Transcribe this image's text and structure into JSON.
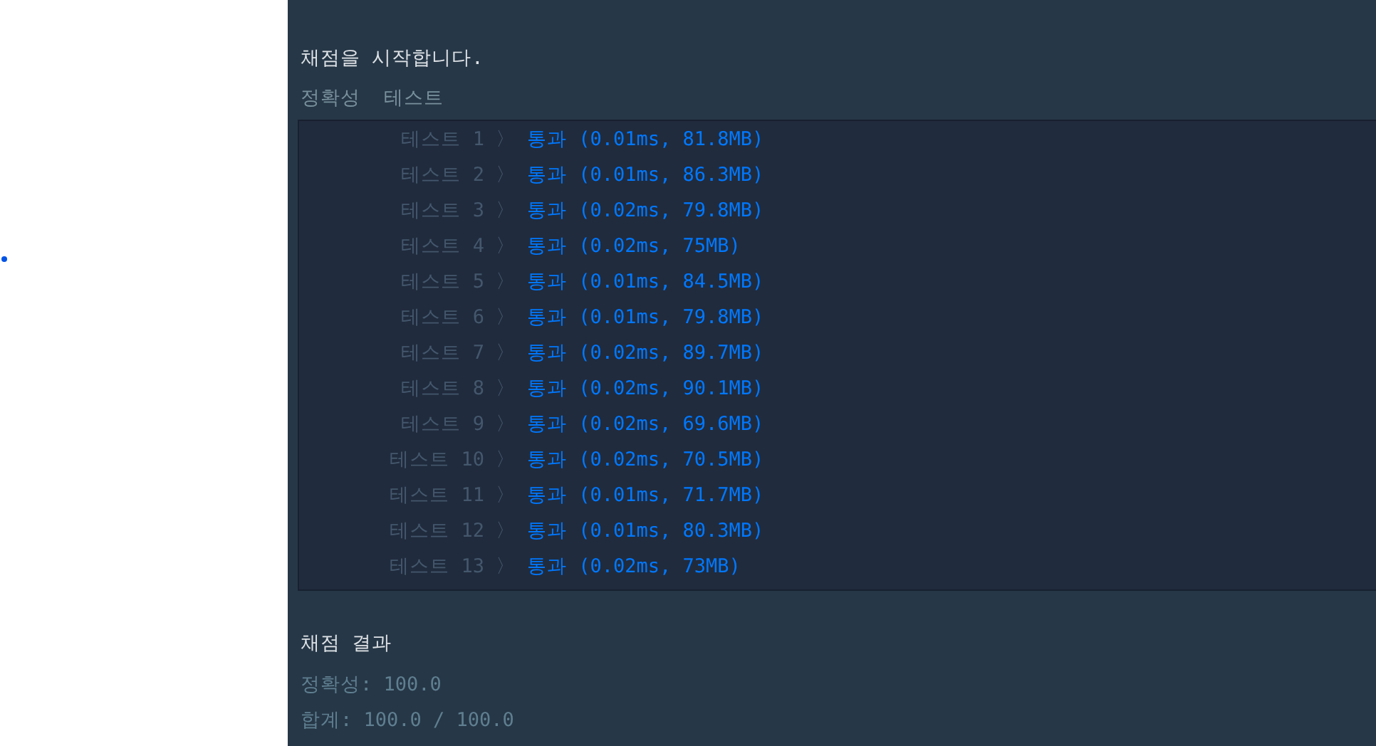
{
  "console": {
    "heading": "채점을 시작합니다.",
    "section_title": "정확성  테스트",
    "tests": [
      {
        "label": "테스트 1",
        "separator": "〉",
        "result": "통과 (0.01ms, 81.8MB)",
        "passed": true
      },
      {
        "label": "테스트 2",
        "separator": "〉",
        "result": "통과 (0.01ms, 86.3MB)",
        "passed": true
      },
      {
        "label": "테스트 3",
        "separator": "〉",
        "result": "통과 (0.02ms, 79.8MB)",
        "passed": true
      },
      {
        "label": "테스트 4",
        "separator": "〉",
        "result": "통과 (0.02ms, 75MB)",
        "passed": true
      },
      {
        "label": "테스트 5",
        "separator": "〉",
        "result": "통과 (0.01ms, 84.5MB)",
        "passed": true
      },
      {
        "label": "테스트 6",
        "separator": "〉",
        "result": "통과 (0.01ms, 79.8MB)",
        "passed": true
      },
      {
        "label": "테스트 7",
        "separator": "〉",
        "result": "통과 (0.02ms, 89.7MB)",
        "passed": true
      },
      {
        "label": "테스트 8",
        "separator": "〉",
        "result": "통과 (0.02ms, 90.1MB)",
        "passed": true
      },
      {
        "label": "테스트 9",
        "separator": "〉",
        "result": "통과 (0.02ms, 69.6MB)",
        "passed": true
      },
      {
        "label": "테스트 10",
        "separator": "〉",
        "result": "통과 (0.02ms, 70.5MB)",
        "passed": true
      },
      {
        "label": "테스트 11",
        "separator": "〉",
        "result": "통과 (0.01ms, 71.7MB)",
        "passed": true
      },
      {
        "label": "테스트 12",
        "separator": "〉",
        "result": "통과 (0.01ms, 80.3MB)",
        "passed": true
      },
      {
        "label": "테스트 13",
        "separator": "〉",
        "result": "통과 (0.02ms, 73MB)",
        "passed": true
      }
    ],
    "summary_title": "채점 결과",
    "summary": [
      "정확성: 100.0",
      "합계: 100.0 / 100.0"
    ]
  }
}
